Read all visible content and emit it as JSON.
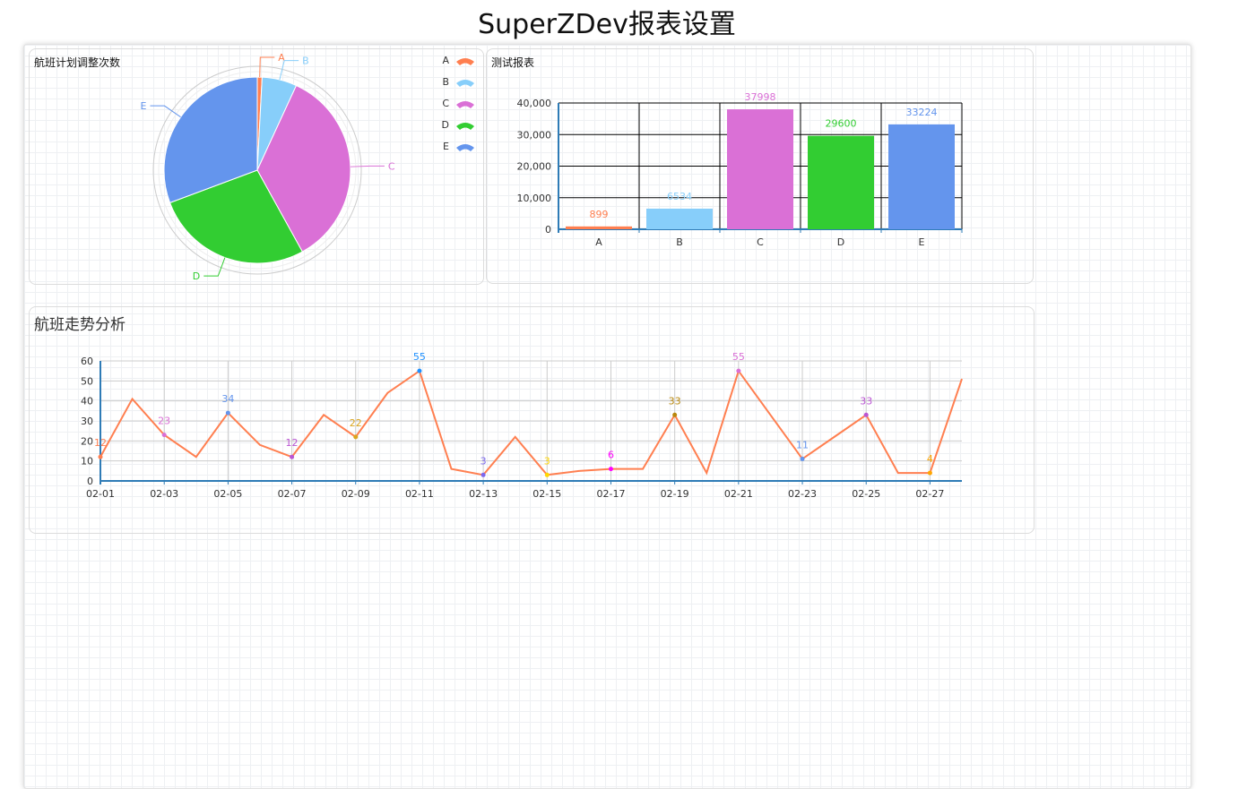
{
  "page": {
    "title": "SuperZDev报表设置"
  },
  "panels": {
    "pie": {
      "title": "航班计划调整次数"
    },
    "bar": {
      "title": "测试报表"
    },
    "line": {
      "title": "航班走势分析"
    }
  },
  "chart_data": [
    {
      "type": "pie",
      "title": "航班计划调整次数",
      "categories": [
        "A",
        "B",
        "C",
        "D",
        "E"
      ],
      "values": [
        899,
        6534,
        37998,
        29600,
        33224
      ],
      "colors": [
        "#ff7f50",
        "#87cefa",
        "#da70d6",
        "#32cd32",
        "#6495ed"
      ],
      "legend": "top-right"
    },
    {
      "type": "bar",
      "title": "测试报表",
      "categories": [
        "A",
        "B",
        "C",
        "D",
        "E"
      ],
      "values": [
        899,
        6534,
        37998,
        29600,
        33224
      ],
      "colors": [
        "#ff7f50",
        "#87cefa",
        "#da70d6",
        "#32cd32",
        "#6495ed"
      ],
      "ylim": [
        0,
        40000
      ],
      "yticks": [
        "0",
        "10,000",
        "20,000",
        "30,000",
        "40,000"
      ],
      "grid": true
    },
    {
      "type": "line",
      "title": "航班走势分析",
      "x": [
        "02-01",
        "02-02",
        "02-03",
        "02-04",
        "02-05",
        "02-06",
        "02-07",
        "02-08",
        "02-09",
        "02-10",
        "02-11",
        "02-12",
        "02-13",
        "02-14",
        "02-15",
        "02-16",
        "02-17",
        "02-18",
        "02-19",
        "02-20",
        "02-21",
        "02-22",
        "02-23",
        "02-24",
        "02-25",
        "02-26",
        "02-27",
        "02-28"
      ],
      "x_ticks": [
        "02-01",
        "02-03",
        "02-05",
        "02-07",
        "02-09",
        "02-11",
        "02-13",
        "02-15",
        "02-17",
        "02-19",
        "02-21",
        "02-23",
        "02-25",
        "02-27"
      ],
      "values": [
        12,
        41,
        23,
        12,
        34,
        18,
        12,
        33,
        22,
        44,
        55,
        6,
        3,
        22,
        3,
        5,
        6,
        6,
        33,
        4,
        55,
        33,
        11,
        22,
        33,
        4,
        4,
        51
      ],
      "labeled_points": [
        {
          "x": "02-01",
          "y": 12,
          "color": "#ff7f50"
        },
        {
          "x": "02-03",
          "y": 23,
          "color": "#da70d6"
        },
        {
          "x": "02-05",
          "y": 34,
          "color": "#6495ed"
        },
        {
          "x": "02-07",
          "y": 12,
          "color": "#ba55d3"
        },
        {
          "x": "02-09",
          "y": 22,
          "color": "#daa520"
        },
        {
          "x": "02-11",
          "y": 55,
          "color": "#1e90ff"
        },
        {
          "x": "02-13",
          "y": 3,
          "color": "#7b68ee"
        },
        {
          "x": "02-15",
          "y": 3,
          "color": "#ffd700"
        },
        {
          "x": "02-17",
          "y": 6,
          "color": "#ff00ff"
        },
        {
          "x": "02-19",
          "y": 33,
          "color": "#b8860b"
        },
        {
          "x": "02-21",
          "y": 55,
          "color": "#da70d6"
        },
        {
          "x": "02-23",
          "y": 11,
          "color": "#6495ed"
        },
        {
          "x": "02-25",
          "y": 33,
          "color": "#ba55d3"
        },
        {
          "x": "02-27",
          "y": 4,
          "color": "#ffa500"
        }
      ],
      "line_color": "#ff7f50",
      "ylim": [
        0,
        60
      ],
      "yticks": [
        "0",
        "10",
        "20",
        "30",
        "40",
        "50",
        "60"
      ],
      "grid": true
    }
  ]
}
